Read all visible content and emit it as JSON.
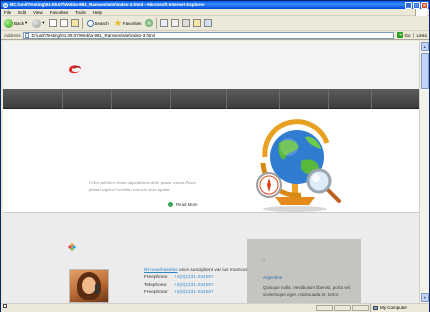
{
  "window": {
    "title": "BC:\\unit\\Testing\\01.09.07\\Web\\a-981_Ramses\\site\\index-3.html - Microsoft Internet Explorer",
    "minimize": "_",
    "maximize": "□",
    "close": "×"
  },
  "menu": [
    "File",
    "Edit",
    "View",
    "Favorites",
    "Tools",
    "Help"
  ],
  "toolbar": {
    "back_label": "Back",
    "search_label": "Search",
    "favorites_label": "Favorites"
  },
  "address": {
    "label": "Address",
    "url": "D:\\unit\\Testing\\01.09.07\\Web\\a-981_Ramses\\site\\index-3.html",
    "go_label": "Go",
    "links_label": "Links"
  },
  "status": {
    "left_text": "",
    "zone_text": "My Computer"
  },
  "page": {
    "hero_text": "Celen adolore elatet ulquoditreto dolo ipsum wisem.Fusce planal sapien.Curabitu rom are aues iquam.",
    "read_more": "Read More",
    "contact": {
      "intro_name": "Ilit maurhaselus",
      "intro_rest": " usce suscipitent var ius mumcus.",
      "rows": [
        {
          "label": "Freephone:",
          "value": "+4(0)1231-234567"
        },
        {
          "label": "Telephone:",
          "value": "+4(0)1231-234567"
        },
        {
          "label": "Freephone:",
          "value": "+4(0)1231-234567"
        }
      ]
    },
    "side": {
      "category": "Argentine",
      "text": "Quisque nulla. Vestibulum libenist, porta vel, scelerisque eget, malesuada et, tortor."
    }
  }
}
